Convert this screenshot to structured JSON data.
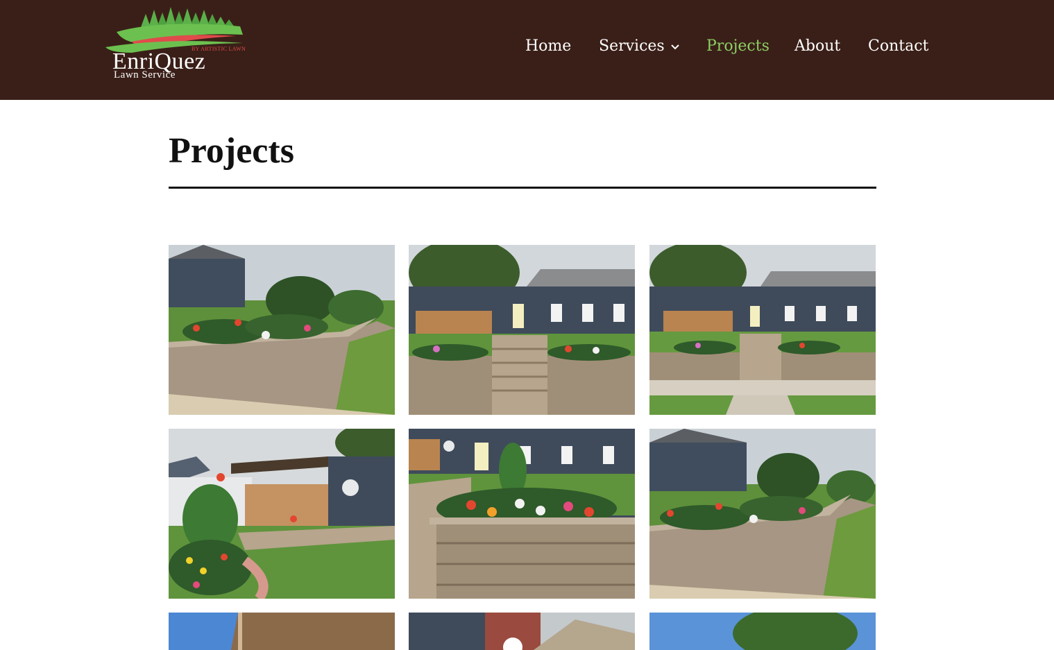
{
  "brand": {
    "name": "EnriQuez",
    "subtitle": "Lawn Service",
    "tagline": "BY ARTISTIC LAWN",
    "colors": {
      "header_bg": "#3a1f18",
      "accent_green": "#8ccf64",
      "accent_red": "#e04b4b"
    }
  },
  "nav": {
    "items": [
      {
        "label": "Home",
        "active": false
      },
      {
        "label": "Services",
        "active": false,
        "has_dropdown": true,
        "icon": "chevron-down-icon"
      },
      {
        "label": "Projects",
        "active": true
      },
      {
        "label": "About",
        "active": false
      },
      {
        "label": "Contact",
        "active": false
      }
    ]
  },
  "page": {
    "title": "Projects"
  },
  "gallery": {
    "photos": [
      {
        "subject": "raised-flower-bed-retaining-wall-side-angle"
      },
      {
        "subject": "front-steps-between-retaining-walls"
      },
      {
        "subject": "front-steps-from-sidewalk"
      },
      {
        "subject": "side-yard-fence-and-planting"
      },
      {
        "subject": "flower-bed-closeup-with-steps"
      },
      {
        "subject": "retaining-wall-flower-bed-angle"
      },
      {
        "subject": "roofline-partial"
      },
      {
        "subject": "brick-house-facade-partial"
      },
      {
        "subject": "tree-and-sky-partial"
      }
    ]
  }
}
